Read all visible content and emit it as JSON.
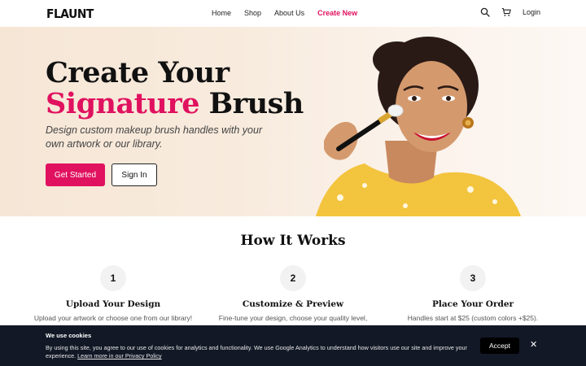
{
  "header": {
    "logo": "FLAUNT",
    "nav": [
      "Home",
      "Shop",
      "About Us"
    ],
    "create_new": "Create New",
    "login": "Login"
  },
  "hero": {
    "title_line1": "Create Your",
    "title_accent": "Signature",
    "title_rest": " Brush",
    "subtitle": "Design custom makeup brush handles with your own artwork or our library.",
    "primary_button": "Get Started",
    "secondary_button": "Sign In"
  },
  "how": {
    "title": "How It Works",
    "steps": [
      {
        "num": "1",
        "title": "Upload Your Design",
        "desc": "Upload your artwork or choose one from our library!"
      },
      {
        "num": "2",
        "title": "Customize & Preview",
        "desc": "Fine-tune your design, choose your quality level,"
      },
      {
        "num": "3",
        "title": "Place Your Order",
        "desc": "Handles start at $25 (custom colors +$25)."
      }
    ]
  },
  "cookie": {
    "title": " We use cookies",
    "text": "By using this site, you agree to our use of cookies for analytics and functionality. We use Google Analytics to understand how visitors use our site and improve your experience. ",
    "link": "Learn more in our Privacy Policy",
    "accept": "Accept",
    "close": "✕"
  },
  "colors": {
    "accent": "#e0115f",
    "banner": "#121826"
  },
  "icons": [
    "search-icon",
    "cart-icon",
    "close-icon"
  ]
}
